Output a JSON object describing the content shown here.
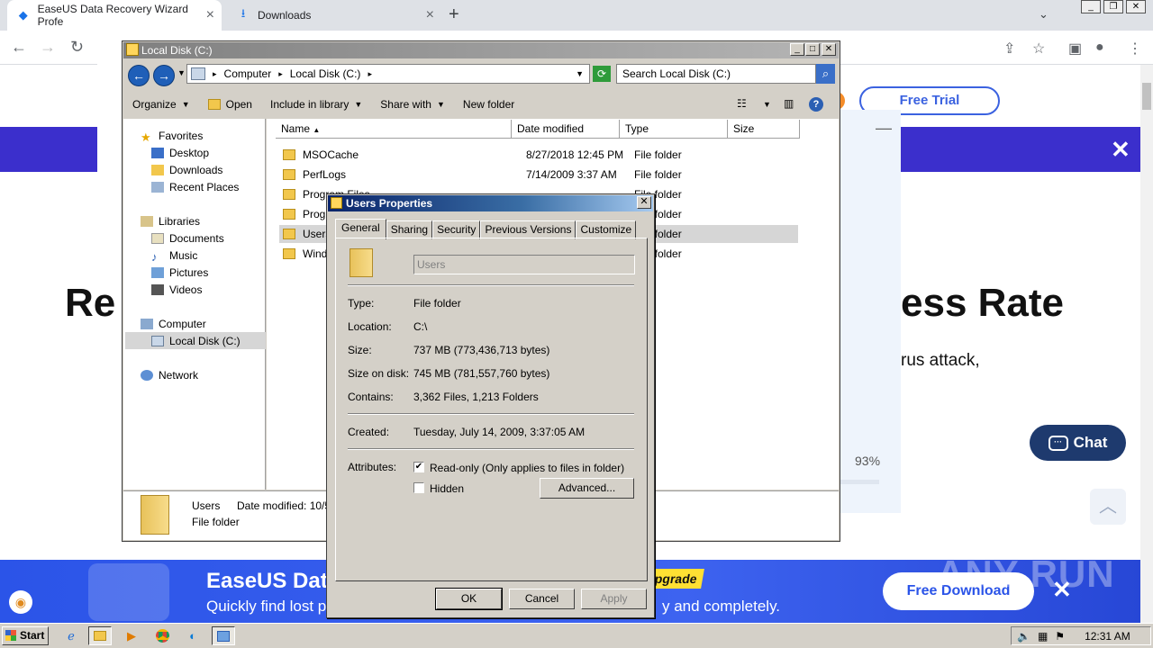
{
  "browser": {
    "tabs": [
      {
        "label": "EaseUS Data Recovery Wizard Profe",
        "active": true
      },
      {
        "label": "Downloads",
        "active": false
      }
    ],
    "new_tab": "+"
  },
  "webpage": {
    "free_trial": "Free Trial",
    "headline_left": "Re",
    "headline_right": "ess Rate",
    "subtext_right": "rus attack,",
    "percent": "93%",
    "chat": "Chat",
    "banner": {
      "title": "EaseUS Dat",
      "subtitle": "Quickly find lost p",
      "subtitle_right": "y and completely.",
      "badge": "pgrade",
      "cta": "Free Download"
    },
    "watermark": "ANY RUN"
  },
  "explorer": {
    "title": "Local Disk (C:)",
    "breadcrumb": [
      "Computer",
      "Local Disk (C:)"
    ],
    "search_placeholder": "Search Local Disk (C:)",
    "commands": [
      "Organize",
      "Open",
      "Include in library",
      "Share with",
      "New folder"
    ],
    "nav": {
      "favorites": "Favorites",
      "favorites_items": [
        "Desktop",
        "Downloads",
        "Recent Places"
      ],
      "libraries": "Libraries",
      "libraries_items": [
        "Documents",
        "Music",
        "Pictures",
        "Videos"
      ],
      "computer": "Computer",
      "computer_items": [
        "Local Disk (C:)"
      ],
      "network": "Network"
    },
    "columns": [
      "Name",
      "Date modified",
      "Type",
      "Size"
    ],
    "rows": [
      {
        "name": "MSOCache",
        "date": "8/27/2018 12:45 PM",
        "type": "File folder"
      },
      {
        "name": "PerfLogs",
        "date": "7/14/2009 3:37 AM",
        "type": "File folder"
      },
      {
        "name": "Program Files",
        "date": "",
        "type": "File folder"
      },
      {
        "name": "Program",
        "date": "",
        "type": "File folder"
      },
      {
        "name": "Users",
        "date": "",
        "type": "File folder"
      },
      {
        "name": "Windo",
        "date": "",
        "type": "File folder"
      }
    ],
    "details": {
      "name": "Users",
      "date_label": "Date modified: 10/5/",
      "type": "File folder"
    }
  },
  "properties": {
    "title": "Users Properties",
    "tabs": [
      "General",
      "Sharing",
      "Security",
      "Previous Versions",
      "Customize"
    ],
    "name_value": "Users",
    "fields": [
      {
        "label": "Type:",
        "value": "File folder"
      },
      {
        "label": "Location:",
        "value": "C:\\"
      },
      {
        "label": "Size:",
        "value": "737 MB (773,436,713 bytes)"
      },
      {
        "label": "Size on disk:",
        "value": "745 MB (781,557,760 bytes)"
      },
      {
        "label": "Contains:",
        "value": "3,362 Files, 1,213 Folders"
      }
    ],
    "created_label": "Created:",
    "created_value": "Tuesday, July 14, 2009, 3:37:05 AM",
    "attributes_label": "Attributes:",
    "readonly_label": "Read-only (Only applies to files in folder)",
    "readonly_checked": true,
    "hidden_label": "Hidden",
    "hidden_checked": false,
    "advanced_button": "Advanced...",
    "ok_button": "OK",
    "cancel_button": "Cancel",
    "apply_button": "Apply"
  },
  "taskbar": {
    "start": "Start",
    "clock": "12:31 AM"
  }
}
